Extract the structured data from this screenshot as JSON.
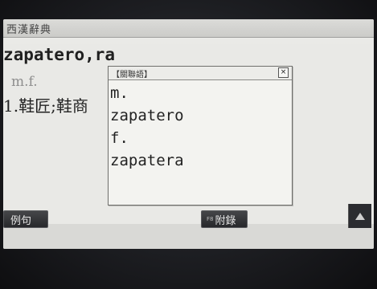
{
  "app": {
    "title": "西漢辭典"
  },
  "entry": {
    "headword": "zapatero,ra",
    "pos": "m.f.",
    "definition": "1.鞋匠;鞋商"
  },
  "popup": {
    "title": "【關聯語】",
    "close_label": "×",
    "lines": [
      "m.",
      "zapatero",
      "f.",
      "zapatera"
    ]
  },
  "softkeys": {
    "left": {
      "fkey": "",
      "label": "例句"
    },
    "middle": {
      "fkey": "F8",
      "label": "附錄"
    },
    "up_icon": "scroll-up-icon"
  }
}
